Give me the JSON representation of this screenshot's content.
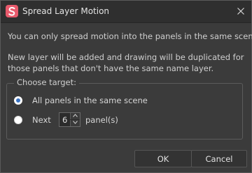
{
  "window": {
    "title": "Spread Layer Motion",
    "close_icon": "close-icon",
    "logo_icon": "app-logo-icon",
    "brand_color": "#e85a6c"
  },
  "messages": {
    "line1": "You can only spread motion into the panels in the same scene.",
    "line2": "New layer will be added and drawing will be duplicated for those panels that don't have the same name layer."
  },
  "target": {
    "group_title": "Choose target:",
    "options": [
      {
        "label": "All panels in the same scene",
        "selected": true
      },
      {
        "label": "Next",
        "selected": false
      }
    ],
    "panel_count": "6",
    "panel_unit": "panel(s)"
  },
  "buttons": {
    "ok": "OK",
    "cancel": "Cancel"
  },
  "colors": {
    "radio_selected": "#3b74c4"
  }
}
